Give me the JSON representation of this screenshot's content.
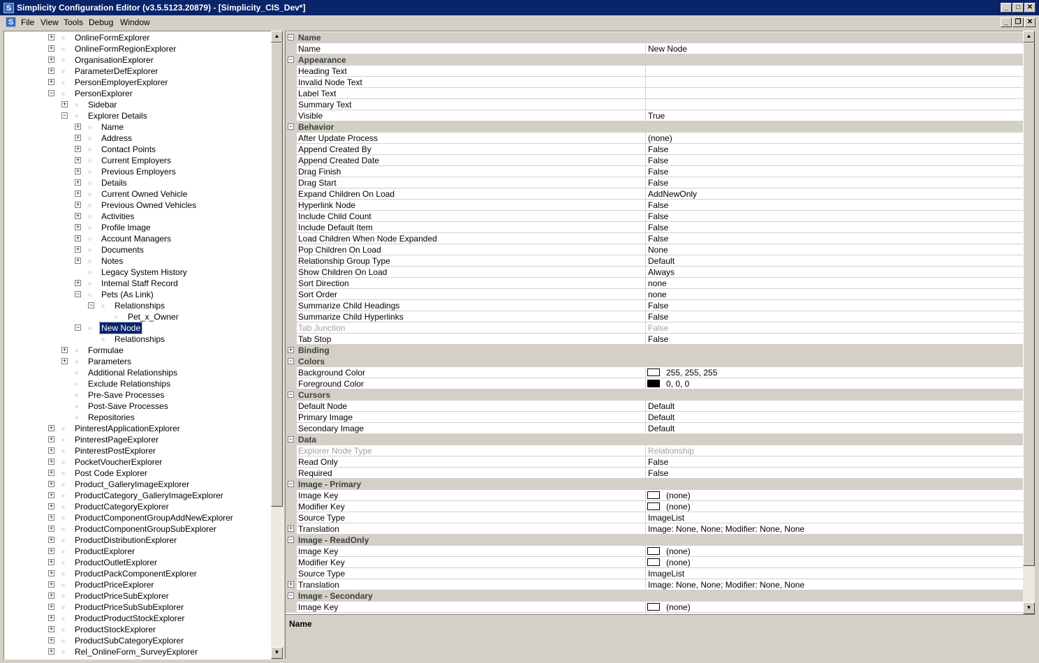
{
  "window": {
    "title": "Simplicity Configuration Editor (v3.5.5123.20879) - [Simplicity_CIS_Dev*]",
    "app_icon": "S"
  },
  "menu": [
    "File",
    "View",
    "Tools",
    "Debug",
    "Window"
  ],
  "tree": [
    {
      "label": "OnlineFormExplorer",
      "level": 0,
      "exp": "+"
    },
    {
      "label": "OnlineFormRegionExplorer",
      "level": 0,
      "exp": "+"
    },
    {
      "label": "OrganisationExplorer",
      "level": 0,
      "exp": "+"
    },
    {
      "label": "ParameterDefExplorer",
      "level": 0,
      "exp": "+"
    },
    {
      "label": "PersonEmployerExplorer",
      "level": 0,
      "exp": "+"
    },
    {
      "label": "PersonExplorer",
      "level": 0,
      "exp": "-"
    },
    {
      "label": "Sidebar",
      "level": 1,
      "exp": "+"
    },
    {
      "label": "Explorer Details",
      "level": 1,
      "exp": "-"
    },
    {
      "label": "Name",
      "level": 2,
      "exp": "+"
    },
    {
      "label": "Address",
      "level": 2,
      "exp": "+"
    },
    {
      "label": "Contact Points",
      "level": 2,
      "exp": "+"
    },
    {
      "label": "Current Employers",
      "level": 2,
      "exp": "+"
    },
    {
      "label": "Previous Employers",
      "level": 2,
      "exp": "+"
    },
    {
      "label": "Details",
      "level": 2,
      "exp": "+"
    },
    {
      "label": "Current Owned Vehicle",
      "level": 2,
      "exp": "+"
    },
    {
      "label": "Previous Owned Vehicles",
      "level": 2,
      "exp": "+"
    },
    {
      "label": "Activities",
      "level": 2,
      "exp": "+"
    },
    {
      "label": "Profile Image",
      "level": 2,
      "exp": "+"
    },
    {
      "label": "Account Managers",
      "level": 2,
      "exp": "+"
    },
    {
      "label": "Documents",
      "level": 2,
      "exp": "+"
    },
    {
      "label": "Notes",
      "level": 2,
      "exp": "+"
    },
    {
      "label": "Legacy System History",
      "level": 2,
      "exp": ""
    },
    {
      "label": "Internal Staff Record",
      "level": 2,
      "exp": "+"
    },
    {
      "label": "Pets (As Link)",
      "level": 2,
      "exp": "-"
    },
    {
      "label": "Relationships",
      "level": 3,
      "exp": "-"
    },
    {
      "label": "Pet_x_Owner",
      "level": 4,
      "exp": ""
    },
    {
      "label": "New Node",
      "level": 2,
      "exp": "-",
      "selected": true
    },
    {
      "label": "Relationships",
      "level": 3,
      "exp": ""
    },
    {
      "label": "Formulae",
      "level": 1,
      "exp": "+"
    },
    {
      "label": "Parameters",
      "level": 1,
      "exp": "+"
    },
    {
      "label": "Additional Relationships",
      "level": 1,
      "exp": ""
    },
    {
      "label": "Exclude Relationships",
      "level": 1,
      "exp": ""
    },
    {
      "label": "Pre-Save Processes",
      "level": 1,
      "exp": ""
    },
    {
      "label": "Post-Save Processes",
      "level": 1,
      "exp": ""
    },
    {
      "label": "Repositories",
      "level": 1,
      "exp": ""
    },
    {
      "label": "PinterestApplicationExplorer",
      "level": 0,
      "exp": "+"
    },
    {
      "label": "PinterestPageExplorer",
      "level": 0,
      "exp": "+"
    },
    {
      "label": "PinterestPostExplorer",
      "level": 0,
      "exp": "+"
    },
    {
      "label": "PocketVoucherExplorer",
      "level": 0,
      "exp": "+"
    },
    {
      "label": "Post Code Explorer",
      "level": 0,
      "exp": "+"
    },
    {
      "label": "Product_GalleryImageExplorer",
      "level": 0,
      "exp": "+"
    },
    {
      "label": "ProductCategory_GalleryImageExplorer",
      "level": 0,
      "exp": "+"
    },
    {
      "label": "ProductCategoryExplorer",
      "level": 0,
      "exp": "+"
    },
    {
      "label": "ProductComponentGroupAddNewExplorer",
      "level": 0,
      "exp": "+"
    },
    {
      "label": "ProductComponentGroupSubExplorer",
      "level": 0,
      "exp": "+"
    },
    {
      "label": "ProductDistributionExplorer",
      "level": 0,
      "exp": "+"
    },
    {
      "label": "ProductExplorer",
      "level": 0,
      "exp": "+"
    },
    {
      "label": "ProductOutletExplorer",
      "level": 0,
      "exp": "+"
    },
    {
      "label": "ProductPackComponentExplorer",
      "level": 0,
      "exp": "+"
    },
    {
      "label": "ProductPriceExplorer",
      "level": 0,
      "exp": "+"
    },
    {
      "label": "ProductPriceSubExplorer",
      "level": 0,
      "exp": "+"
    },
    {
      "label": "ProductPriceSubSubExplorer",
      "level": 0,
      "exp": "+"
    },
    {
      "label": "ProductProductStockExplorer",
      "level": 0,
      "exp": "+"
    },
    {
      "label": "ProductStockExplorer",
      "level": 0,
      "exp": "+"
    },
    {
      "label": "ProductSubCategoryExplorer",
      "level": 0,
      "exp": "+"
    },
    {
      "label": "Rel_OnlineForm_SurveyExplorer",
      "level": 0,
      "exp": "+"
    }
  ],
  "properties": [
    {
      "cat": "Name",
      "exp": "-"
    },
    {
      "name": "Name",
      "value": "New Node"
    },
    {
      "cat": "Appearance",
      "exp": "-"
    },
    {
      "name": "Heading Text",
      "value": ""
    },
    {
      "name": "Invalid Node Text",
      "value": ""
    },
    {
      "name": "Label Text",
      "value": ""
    },
    {
      "name": "Summary Text",
      "value": ""
    },
    {
      "name": "Visible",
      "value": "True"
    },
    {
      "cat": "Behavior",
      "exp": "-"
    },
    {
      "name": "After Update Process",
      "value": "(none)"
    },
    {
      "name": "Append Created By",
      "value": "False"
    },
    {
      "name": "Append Created Date",
      "value": "False"
    },
    {
      "name": "Drag Finish",
      "value": "False"
    },
    {
      "name": "Drag Start",
      "value": "False"
    },
    {
      "name": "Expand Children On Load",
      "value": "AddNewOnly"
    },
    {
      "name": "Hyperlink Node",
      "value": "False"
    },
    {
      "name": "Include Child Count",
      "value": "False"
    },
    {
      "name": "Include Default Item",
      "value": "False"
    },
    {
      "name": "Load Children When Node Expanded",
      "value": "False"
    },
    {
      "name": "Pop Children On Load",
      "value": "None"
    },
    {
      "name": "Relationship Group Type",
      "value": "Default"
    },
    {
      "name": "Show Children On Load",
      "value": "Always"
    },
    {
      "name": "Sort Direction",
      "value": "none"
    },
    {
      "name": "Sort Order",
      "value": "none"
    },
    {
      "name": "Summarize Child Headings",
      "value": "False"
    },
    {
      "name": "Summarize Child Hyperlinks",
      "value": "False"
    },
    {
      "name": "Tab Junction",
      "value": "False",
      "dim": true
    },
    {
      "name": "Tab Stop",
      "value": "False"
    },
    {
      "cat": "Binding",
      "exp": "+"
    },
    {
      "cat": "Colors",
      "exp": "-"
    },
    {
      "name": "Background Color",
      "value": "255, 255, 255",
      "swatch": "#ffffff"
    },
    {
      "name": "Foreground Color",
      "value": "0, 0, 0",
      "swatch": "#000000"
    },
    {
      "cat": "Cursors",
      "exp": "-"
    },
    {
      "name": "Default Node",
      "value": "Default"
    },
    {
      "name": "Primary Image",
      "value": "Default"
    },
    {
      "name": "Secondary Image",
      "value": "Default"
    },
    {
      "cat": "Data",
      "exp": "-"
    },
    {
      "name": "Explorer Node Type",
      "value": "Relationship",
      "dim": true
    },
    {
      "name": "Read Only",
      "value": "False"
    },
    {
      "name": "Required",
      "value": "False"
    },
    {
      "cat": "Image - Primary",
      "exp": "-"
    },
    {
      "name": "Image Key",
      "value": "(none)",
      "swatch": "#ffffff"
    },
    {
      "name": "Modifier Key",
      "value": "(none)",
      "swatch": "#ffffff"
    },
    {
      "name": "Source Type",
      "value": "ImageList"
    },
    {
      "name": "Translation",
      "value": "Image: None, None; Modifier: None, None",
      "exp": "+"
    },
    {
      "cat": "Image - ReadOnly",
      "exp": "-"
    },
    {
      "name": "Image Key",
      "value": "(none)",
      "swatch": "#ffffff"
    },
    {
      "name": "Modifier Key",
      "value": "(none)",
      "swatch": "#ffffff"
    },
    {
      "name": "Source Type",
      "value": "ImageList"
    },
    {
      "name": "Translation",
      "value": "Image: None, None; Modifier: None, None",
      "exp": "+"
    },
    {
      "cat": "Image - Secondary",
      "exp": "-"
    },
    {
      "name": "Image Key",
      "value": "(none)",
      "swatch": "#ffffff"
    }
  ],
  "help": {
    "title": "Name"
  },
  "colors": {
    "titlebar": "#0a246a",
    "selection": "#0a246a",
    "face": "#d4d0c8"
  }
}
